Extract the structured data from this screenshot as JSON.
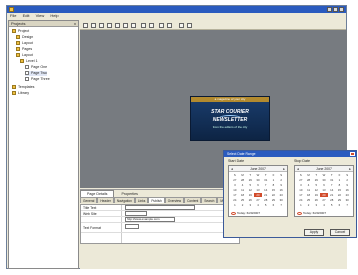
{
  "window": {
    "title": ""
  },
  "menu": [
    "File",
    "Edit",
    "View",
    "Help"
  ],
  "tree": {
    "header": "Projects",
    "close": "x",
    "nodes": [
      {
        "label": "Project",
        "indent": 0
      },
      {
        "label": "Design",
        "indent": 1
      },
      {
        "label": "Layout",
        "indent": 1
      },
      {
        "label": "Pages",
        "indent": 1
      },
      {
        "label": "Layout",
        "indent": 1
      },
      {
        "label": "Level 1",
        "indent": 2
      },
      {
        "label": "Page One",
        "indent": 3
      },
      {
        "label": "Page Two",
        "indent": 3
      },
      {
        "label": "Page Three",
        "indent": 3
      },
      {
        "label": "Templates",
        "indent": 0
      },
      {
        "label": "Library",
        "indent": 0
      }
    ]
  },
  "logo": {
    "top": "a magazine of your city",
    "line1": "STAR COURIER",
    "line2": "NEWSLETTER",
    "line3": "from the editors of the city"
  },
  "properties": {
    "tabs": [
      "Page Details",
      "Properties"
    ],
    "subtabs": [
      "General",
      "Header",
      "Navigation",
      "Links",
      "Publish",
      "Overview",
      "Content",
      "Search",
      "Media",
      "Extra"
    ],
    "rows": [
      {
        "label": "Title Text"
      },
      {
        "label": "Web Site"
      },
      {
        "label": ""
      },
      {
        "label": "Text Format"
      }
    ],
    "url_value": "http://www.example.com"
  },
  "date_dialog": {
    "title": "Select Date Range",
    "start_label": "Start Date",
    "stop_label": "Stop Date",
    "start_month": "June 2007",
    "stop_month": "June 2007",
    "weekdays": [
      "S",
      "M",
      "T",
      "W",
      "T",
      "F",
      "S"
    ],
    "days": [
      "27",
      "28",
      "29",
      "30",
      "31",
      "1",
      "2",
      "3",
      "4",
      "5",
      "6",
      "7",
      "8",
      "9",
      "10",
      "11",
      "12",
      "13",
      "14",
      "15",
      "16",
      "17",
      "18",
      "19",
      "20",
      "21",
      "22",
      "23",
      "24",
      "25",
      "26",
      "27",
      "28",
      "29",
      "30",
      "1",
      "2",
      "3",
      "4",
      "5",
      "6",
      "7"
    ],
    "start_today": "Today: 6/20/2007",
    "stop_today": "Today: 6/20/2007",
    "apply": "Apply",
    "cancel": "Cancel"
  }
}
